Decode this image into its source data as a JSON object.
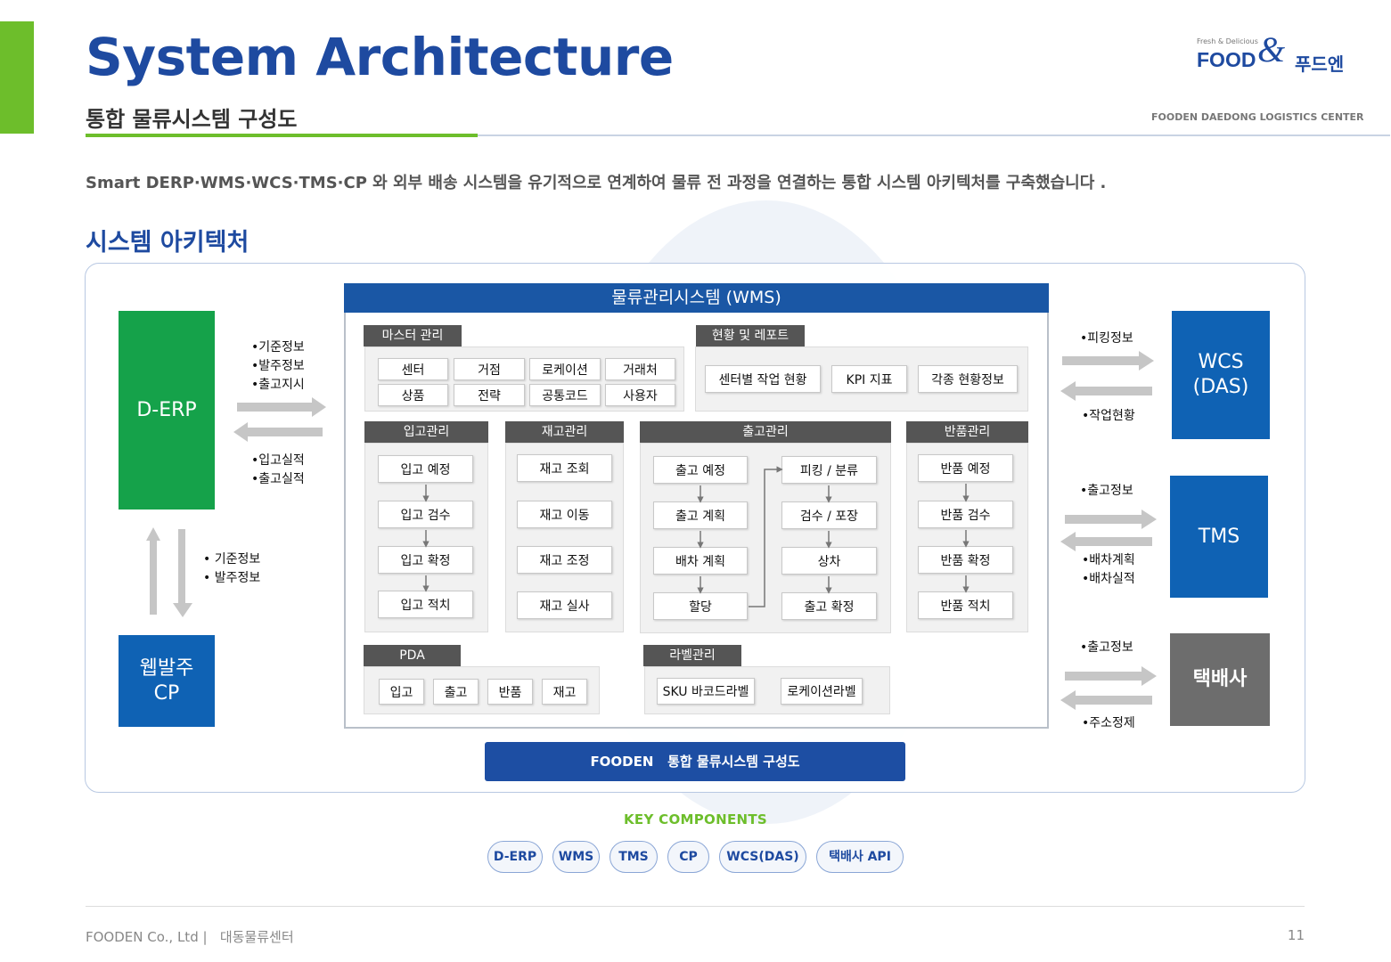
{
  "header": {
    "title": "System Architecture",
    "subtitle": "통합 물류시스템 구성도",
    "logo_tagline": "Fresh & Delicious",
    "logo_food": "FOOD",
    "logo_amp": "&",
    "logo_korean": "푸드엔",
    "center_name": "FOODEN DAEDONG LOGISTICS CENTER"
  },
  "intro": "Smart DERP·WMS·WCS·TMS·CP 와 외부 배송 시스템을 유기적으로 연계하여 물류 전 과정을 연결하는 통합 시스템 아키텍처를 구축했습니다 .",
  "section_title": "시스템 아키텍처",
  "diagram": {
    "derp": "D-ERP",
    "web_order_line1": "웹발주",
    "web_order_line2": "CP",
    "wcs_line1": "WCS",
    "wcs_line2": "(DAS)",
    "tms": "TMS",
    "courier": "택배사",
    "wms_title": "물류관리시스템 (WMS)",
    "derp_out_notes": [
      "•기준정보",
      "•발주정보",
      "•출고지시"
    ],
    "derp_in_notes": [
      "•입고실적",
      "•출고실적"
    ],
    "cp_notes": [
      "• 기준정보",
      "• 발주정보"
    ],
    "wcs_out_note": "•피킹정보",
    "wcs_in_note": "•작업현황",
    "tms_out_note": "•출고정보",
    "tms_in_notes": [
      "•배차계획",
      "•배차실적"
    ],
    "courier_out_note": "•출고정보",
    "courier_in_note": "•주소정제",
    "master": {
      "label": "마스터 관리",
      "items": [
        "센터",
        "거점",
        "로케이션",
        "거래처",
        "상품",
        "전략",
        "공통코드",
        "사용자"
      ]
    },
    "report": {
      "label": "현황 및 레포트",
      "items": [
        "센터별 작업 현황",
        "KPI 지표",
        "각종 현황정보"
      ]
    },
    "inbound": {
      "label": "입고관리",
      "items": [
        "입고 예정",
        "입고 검수",
        "입고 확정",
        "입고 적치"
      ]
    },
    "inventory": {
      "label": "재고관리",
      "items": [
        "재고 조회",
        "재고 이동",
        "재고 조정",
        "재고 실사"
      ]
    },
    "outbound": {
      "label": "출고관리",
      "left": [
        "출고 예정",
        "출고 계획",
        "배차 계획",
        "할당"
      ],
      "right": [
        "피킹 / 분류",
        "검수 / 포장",
        "상차",
        "출고 확정"
      ]
    },
    "returns": {
      "label": "반품관리",
      "items": [
        "반품 예정",
        "반품 검수",
        "반품 확정",
        "반품 적치"
      ]
    },
    "pda": {
      "label": "PDA",
      "items": [
        "입고",
        "출고",
        "반품",
        "재고"
      ]
    },
    "label_mgmt": {
      "label": "라벨관리",
      "items": [
        "SKU 바코드라벨",
        "로케이션라벨"
      ]
    },
    "caption": "FOODEN   통합 물류시스템 구성도"
  },
  "key_components": {
    "title": "KEY COMPONENTS",
    "items": [
      "D-ERP",
      "WMS",
      "TMS",
      "CP",
      "WCS(DAS)",
      "택배사  API"
    ]
  },
  "footer": {
    "company": "FOODEN Co., Ltd |   대동물류센터",
    "page": "11"
  },
  "colors": {
    "brand_blue": "#1e4aa0",
    "wms_blue": "#1a57a5",
    "accent_green": "#6dbe2b",
    "derp_green": "#15a24a",
    "courier_grey": "#6d6d6d"
  }
}
